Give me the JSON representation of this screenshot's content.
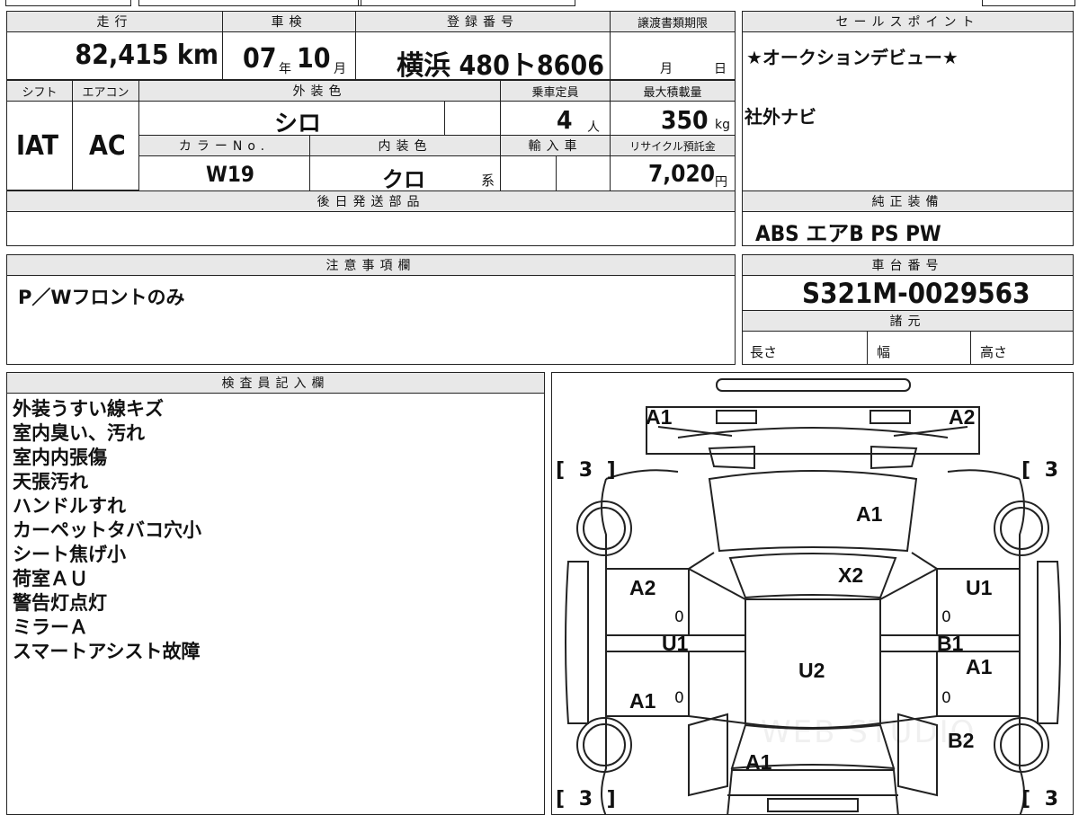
{
  "header": {
    "mileage_label": "走行",
    "inspection_label": "車検",
    "registration_label": "登録番号",
    "transfer_deadline_label": "譲渡書類期限",
    "sales_point_label": "セールスポイント",
    "mileage_value": "82,415 km",
    "inspection_year": "07",
    "inspection_year_unit": "年",
    "inspection_month": "10",
    "inspection_month_unit": "月",
    "registration_value": "横浜 480ト8606",
    "deadline_month": "月",
    "deadline_day": "日"
  },
  "specs": {
    "shift_label": "シフト",
    "aircon_label": "エアコン",
    "exterior_color_label": "外装色",
    "capacity_label": "乗車定員",
    "max_load_label": "最大積載量",
    "shift_value": "IAT",
    "aircon_value": "AC",
    "exterior_color_value": "シロ",
    "capacity_value": "4",
    "capacity_unit": "人",
    "max_load_value": "350",
    "max_load_unit": "kg",
    "color_no_label": "カラーNo.",
    "interior_color_label": "内装色",
    "import_label": "輸入車",
    "recycle_label": "リサイクル預託金",
    "color_no_value": "W19",
    "interior_color_value": "クロ",
    "interior_color_suffix": "系",
    "recycle_value": "7,020",
    "recycle_unit": "円",
    "later_parts_label": "後日発送部品"
  },
  "sales_points": {
    "line1": "★オークションデビュー★",
    "line2": "社外ナビ"
  },
  "equipment": {
    "label": "純正装備",
    "value": "ABS エアB PS PW"
  },
  "notes": {
    "label": "注意事項欄",
    "value": "P／Wフロントのみ"
  },
  "chassis": {
    "label": "車台番号",
    "value": "S321M-0029563",
    "dims_label": "諸元",
    "length_label": "長さ",
    "width_label": "幅",
    "height_label": "高さ"
  },
  "inspector": {
    "label": "検査員記入欄",
    "lines": [
      "外装うすい線キズ",
      "室内臭い、汚れ",
      "室内内張傷",
      "天張汚れ",
      "ハンドルすれ",
      "カーペットタバコ穴小",
      "シート焦げ小",
      "荷室ＡＵ",
      "警告灯点灯",
      "ミラーＡ",
      "スマートアシスト故障"
    ]
  },
  "diagram": {
    "front_left": "A1",
    "front_right": "A2",
    "bracket_tl": "[ 3 ]",
    "bracket_tr": "[ 3 ]",
    "bracket_bl": "[ 3 ]",
    "bracket_br": "[ 3 ]",
    "windshield": "A1",
    "roof_front": "X2",
    "left_front_door": "A2",
    "left_mid": "U1",
    "left_rear_door": "A1",
    "right_front_door": "U1",
    "right_mid": "B1",
    "right_rear_door": "A1",
    "roof": "U2",
    "right_rear_quarter": "B2",
    "rear": "A1",
    "zero": "0",
    "watermark": "WEB STUDIO"
  }
}
